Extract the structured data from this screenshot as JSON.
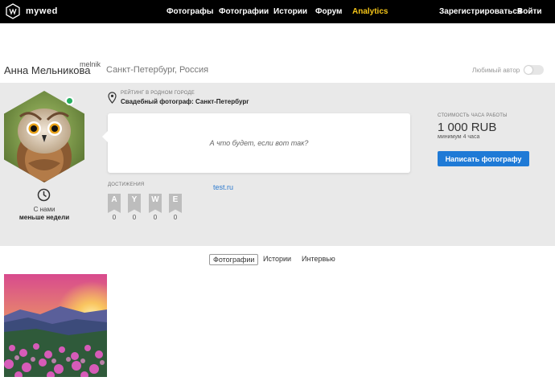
{
  "header": {
    "logo_text": "mywed",
    "nav": [
      {
        "label": "Фотографы"
      },
      {
        "label": "Фотографии"
      },
      {
        "label": "Истории"
      },
      {
        "label": "Форум"
      },
      {
        "label": "Analytics"
      }
    ],
    "register_label": "Зарегистрироваться",
    "login_label": "Войти"
  },
  "profile": {
    "name": "Анна Мельникова",
    "username": "melnik",
    "location": "Санкт-Петербург, Россия",
    "favorite_label": "Любимый автор",
    "with_us_label": "С нами",
    "with_us_value": "меньше недели",
    "rating_label": "РЕЙТИНГ В РОДНОМ ГОРОДЕ",
    "rating_value": "Свадебный фотограф: Санкт-Петербург",
    "quote": "А что будет, если вот так?",
    "achievements_label": "ДОСТИЖЕНИЯ",
    "achievements": [
      {
        "letter": "A",
        "count": "0"
      },
      {
        "letter": "Y",
        "count": "0"
      },
      {
        "letter": "W",
        "count": "0"
      },
      {
        "letter": "E",
        "count": "0"
      }
    ],
    "site_link": "test.ru",
    "price_label": "СТОИМОСТЬ ЧАСА РАБОТЫ",
    "price_value": "1 000 RUB",
    "price_note": "минимум 4 часа",
    "write_button": "Написать фотографу"
  },
  "tabs": [
    {
      "label": "Фотографии",
      "active": true
    },
    {
      "label": "Истории",
      "active": false
    },
    {
      "label": "Интервью",
      "active": false
    }
  ],
  "colors": {
    "accent": "#1f7ad6",
    "analytics": "#f5c518",
    "online": "#27ae60",
    "panel": "#e9e9e9"
  }
}
